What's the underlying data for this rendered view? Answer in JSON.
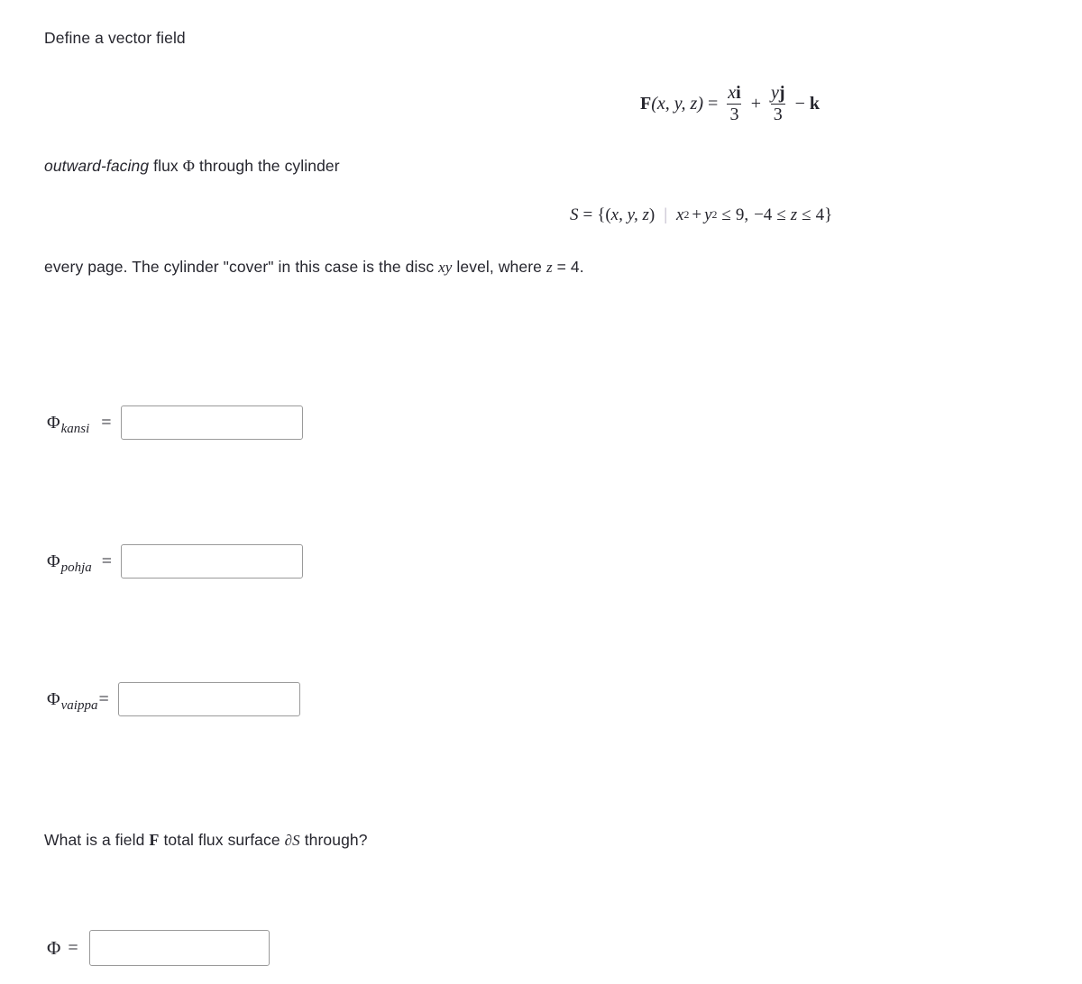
{
  "page": {
    "background": "#ffffff",
    "text_color": "#26262e"
  },
  "prompt": {
    "define_line": "Define a vector field",
    "outward_emphasis": "outward-facing",
    "outward_rest": " flux ",
    "outward_phi": "Φ",
    "outward_tail": " through the cylinder",
    "every_page_pre": "every page. The cylinder \"cover\" in this case is the disc ",
    "every_page_math_xy": "xy",
    "every_page_mid": " level, where ",
    "every_page_math_z": "z",
    "every_page_post": " = 4.",
    "question_pre": "What is a field ",
    "question_bold_F": "F",
    "question_mid": " total flux surface ",
    "question_math_dS": "∂S",
    "question_post": " through?"
  },
  "math": {
    "field_definition": {
      "lhs_bold_F": "F",
      "lhs_args": "(x, y, z)",
      "equals": "=",
      "term1_num_var": "x",
      "term1_num_vec": "i",
      "term1_den": "3",
      "plus": "+",
      "term2_num_var": "y",
      "term2_num_vec": "j",
      "term2_den": "3",
      "minus": "−",
      "term3_vec": "k",
      "plain_text": "F(x, y, z) = x i / 3 + y j / 3 − k"
    },
    "surface_set": {
      "lhs": "S",
      "equals": "=",
      "open_brace": "{(",
      "tuple": "x, y, z",
      "close_paren": ")",
      "separator_bar": "|",
      "x_var": "x",
      "x_exp": "2",
      "plus": "+",
      "y_var": "y",
      "y_exp": "2",
      "le1": "≤",
      "radius_sq": "9",
      "comma": ",",
      "zmin": "−4",
      "le2": "≤",
      "z_var": "z",
      "le3": "≤",
      "zmax": "4",
      "close_brace": "}",
      "plain_text": "S = {(x, y, z) | x² + y² ≤ 9, −4 ≤ z ≤ 4}"
    }
  },
  "answers": [
    {
      "id": "kansi",
      "symbol": "Φ",
      "subscript": "kansi",
      "equals": "=",
      "value": "",
      "placeholder": ""
    },
    {
      "id": "pohja",
      "symbol": "Φ",
      "subscript": "pohja",
      "equals": "=",
      "value": "",
      "placeholder": ""
    },
    {
      "id": "vaippa",
      "symbol": "Φ",
      "subscript": "vaippa",
      "equals": "=",
      "value": "",
      "placeholder": ""
    },
    {
      "id": "total",
      "symbol": "Φ",
      "subscript": "",
      "equals": "=",
      "value": "",
      "placeholder": ""
    }
  ]
}
